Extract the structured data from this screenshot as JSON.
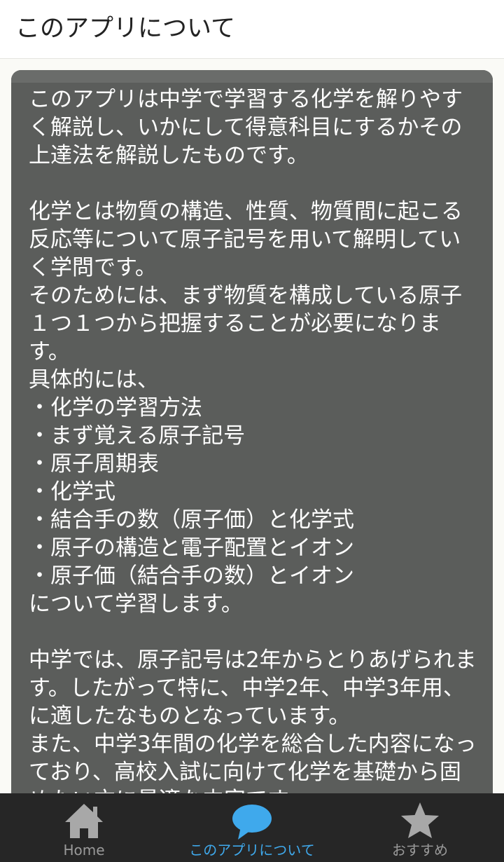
{
  "app_bar": {
    "title": "このアプリについて"
  },
  "content": {
    "description": "このアプリは中学で学習する化学を解りやすく解説し、いかにして得意科目にするかその上達法を解説したものです。\n\n化学とは物質の構造、性質、物質間に起こる反応等について原子記号を用いて解明していく学問です。\nそのためには、まず物質を構成している原子１つ１つから把握することが必要になります。\n具体的には、\n・化学の学習方法\n・まず覚える原子記号\n・原子周期表\n・化学式\n・結合手の数（原子価）と化学式\n・原子の構造と電子配置とイオン\n・原子価（結合手の数）とイオン\nについて学習します。\n\n中学では、原子記号は2年からとりあげられます。したがって特に、中学2年、中学3年用、に適したなものとなっています。\nまた、中学3年間の化学を総合した内容になっており、高校入試に向けて化学を基礎から固めたい方に最適な内容です。"
  },
  "bottom_nav": {
    "items": [
      {
        "label": "Home",
        "icon": "home-icon"
      },
      {
        "label": "このアプリについて",
        "icon": "speech-bubble-icon"
      },
      {
        "label": "おすすめ",
        "icon": "star-icon"
      }
    ],
    "active_index": 1
  },
  "colors": {
    "panel_bg": "#5b5d5b",
    "nav_bg": "#262626",
    "nav_inactive": "#9a9a9a",
    "nav_active": "#3fa9ec",
    "icon_inactive": "#a8a8a8"
  }
}
